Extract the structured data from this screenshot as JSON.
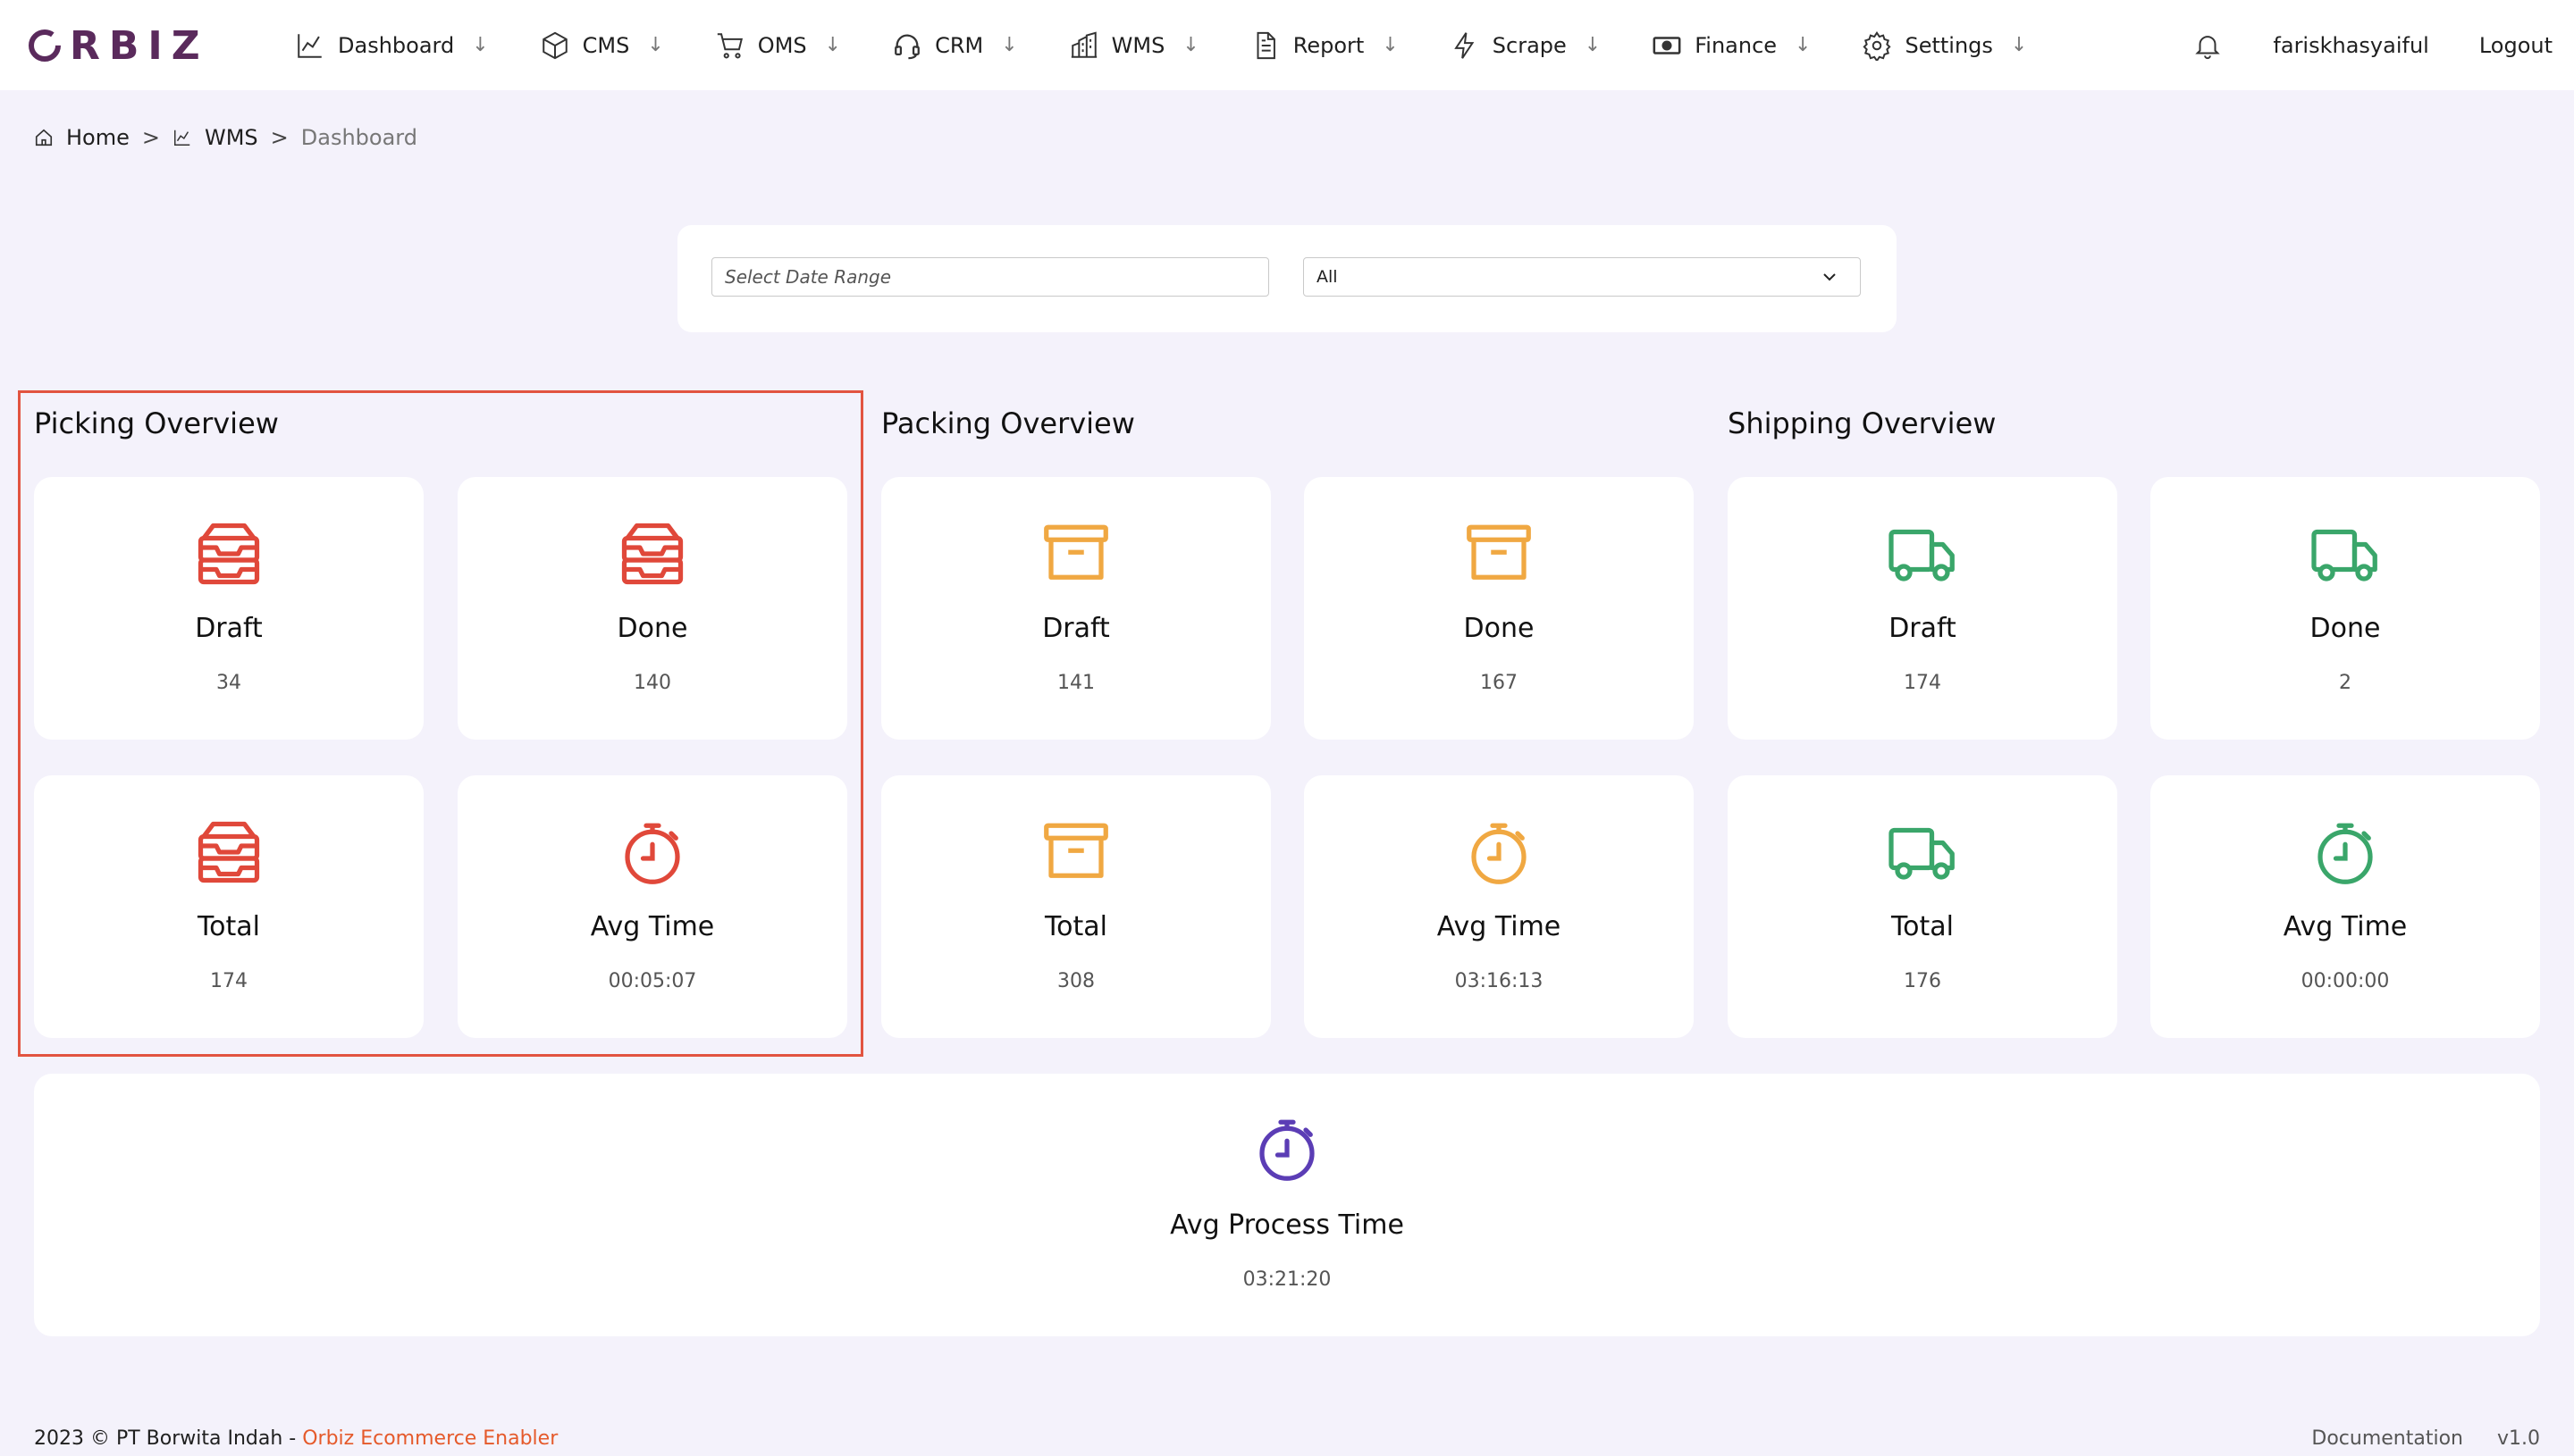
{
  "brand": {
    "logo_text": "RBIZ",
    "color": "#5a2a5c"
  },
  "nav": {
    "items": [
      {
        "label": "Dashboard",
        "icon": "chart-line-icon"
      },
      {
        "label": "CMS",
        "icon": "box-icon"
      },
      {
        "label": "OMS",
        "icon": "cart-icon"
      },
      {
        "label": "CRM",
        "icon": "headset-icon"
      },
      {
        "label": "WMS",
        "icon": "building-icon"
      },
      {
        "label": "Report",
        "icon": "document-icon"
      },
      {
        "label": "Scrape",
        "icon": "lightning-icon"
      },
      {
        "label": "Finance",
        "icon": "money-icon"
      },
      {
        "label": "Settings",
        "icon": "gear-icon"
      }
    ],
    "arrow": "↓",
    "user": "fariskhasyaiful",
    "logout": "Logout"
  },
  "breadcrumb": {
    "home": "Home",
    "sep": ">",
    "section": "WMS",
    "current": "Dashboard"
  },
  "filters": {
    "date_placeholder": "Select Date Range",
    "select_value": "All"
  },
  "colors": {
    "picking": "#e0483a",
    "packing": "#f0a842",
    "shipping": "#3aa66a",
    "process": "#5b3db5",
    "highlight": "#e25440"
  },
  "picking": {
    "title": "Picking Overview",
    "draft": {
      "label": "Draft",
      "value": "34"
    },
    "done": {
      "label": "Done",
      "value": "140"
    },
    "total": {
      "label": "Total",
      "value": "174"
    },
    "avg": {
      "label": "Avg Time",
      "value": "00:05:07"
    }
  },
  "packing": {
    "title": "Packing Overview",
    "draft": {
      "label": "Draft",
      "value": "141"
    },
    "done": {
      "label": "Done",
      "value": "167"
    },
    "total": {
      "label": "Total",
      "value": "308"
    },
    "avg": {
      "label": "Avg Time",
      "value": "03:16:13"
    }
  },
  "shipping": {
    "title": "Shipping Overview",
    "draft": {
      "label": "Draft",
      "value": "174"
    },
    "done": {
      "label": "Done",
      "value": "2"
    },
    "total": {
      "label": "Total",
      "value": "176"
    },
    "avg": {
      "label": "Avg Time",
      "value": "00:00:00"
    }
  },
  "process": {
    "label": "Avg Process Time",
    "value": "03:21:20"
  },
  "footer": {
    "copyright": "2023 © PT Borwita Indah - ",
    "brand_link": "Orbiz Ecommerce Enabler",
    "documentation": "Documentation",
    "version": "v1.0"
  }
}
